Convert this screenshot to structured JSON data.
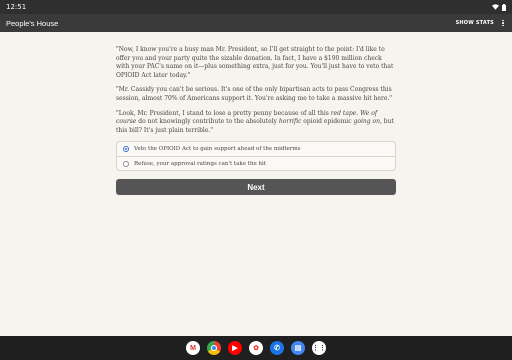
{
  "status_bar": {
    "time": "12:51"
  },
  "app_bar": {
    "title": "People's House",
    "action": "SHOW STATS"
  },
  "story": {
    "paragraphs": [
      "\"Now, I know you're a busy man Mr. President, so I'll get straight to the point: I'd like to offer you and your party quite the sizable donation. In fact, I have a $190 million check with your PAC's name on it—plus something extra, just for you. You'll just have to veto that OPIOID Act later today.\"",
      "\"Mr. Cassidy you can't be serious. It's one of the only bipartisan acts to pass Congress this session, almost 70% of Americans support it. You're asking me to take a massive hit here.\""
    ],
    "p3_part1": "\"Look, Mr. President, I stand to lose a pretty penny because of all this ",
    "p3_em1": "red tape",
    "p3_part2": ". ",
    "p3_em2": "We of course",
    "p3_part3": " do not knowingly contribute to the absolutely ",
    "p3_em3": "horrific",
    "p3_part4": " opioid epidemic ",
    "p3_em4": "going on",
    "p3_part5": ", but this bill? It's just plain terrible.\""
  },
  "choices": [
    {
      "label": "Veto the OPIOID Act to gain support ahead of the midterms",
      "selected": true
    },
    {
      "label": "Refuse, your approval ratings can't take the hit",
      "selected": false
    }
  ],
  "next_button": {
    "label": "Next"
  },
  "dock": {
    "apps": [
      {
        "name": "gmail-icon",
        "glyph": "M",
        "color": "#ffffff",
        "text_color": "#d93025"
      },
      {
        "name": "chrome-icon",
        "glyph": "",
        "color": "#34a853",
        "text_color": "#ffffff"
      },
      {
        "name": "youtube-icon",
        "glyph": "▶",
        "color": "#ff0000",
        "text_color": "#ffffff"
      },
      {
        "name": "photos-icon",
        "glyph": "✿",
        "color": "#ffffff",
        "text_color": "#ea4335"
      },
      {
        "name": "phone-icon",
        "glyph": "✆",
        "color": "#1a73e8",
        "text_color": "#ffffff"
      },
      {
        "name": "messages-icon",
        "glyph": "▤",
        "color": "#4285f4",
        "text_color": "#ffffff"
      },
      {
        "name": "app-drawer-icon",
        "glyph": "⋮⋮",
        "color": "#ffffff",
        "text_color": "#3c4043"
      }
    ]
  }
}
